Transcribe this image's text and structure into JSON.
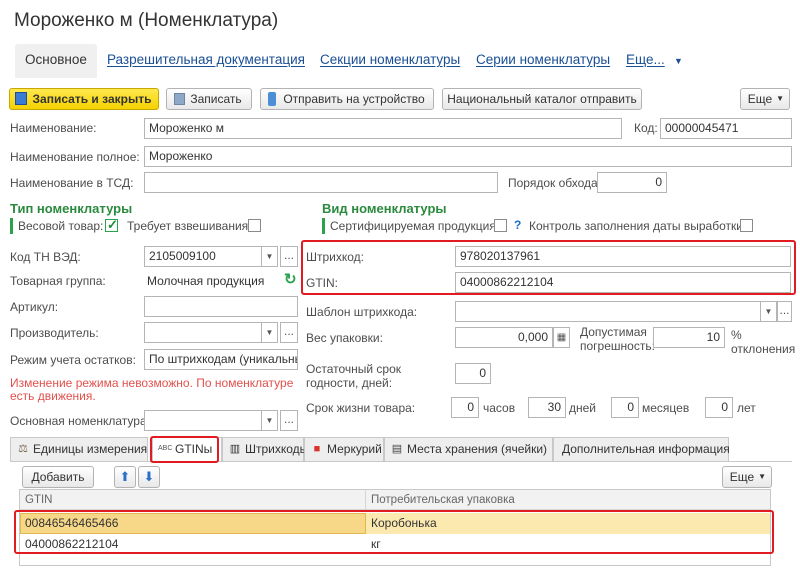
{
  "window": {
    "title": "Мороженко м (Номенклатура)"
  },
  "nav": {
    "tabs": [
      "Основное",
      "Разрешительная документация",
      "Секции номенклатуры",
      "Серии номенклатуры",
      "Еще..."
    ]
  },
  "toolbar": {
    "save_close": "Записать и закрыть",
    "save": "Записать",
    "send_device": "Отправить на устройство",
    "national_catalog": "Национальный каталог отправить",
    "more": "Еще"
  },
  "form": {
    "name_label": "Наименование:",
    "name_value": "Мороженко м",
    "code_label": "Код:",
    "code_value": "00000045471",
    "full_name_label": "Наименование полное:",
    "full_name_value": "Мороженко",
    "tsd_name_label": "Наименование в ТСД:",
    "tsd_name_value": "",
    "bypass_label": "Порядок обхода:",
    "bypass_value": "0"
  },
  "nomenclature_type": {
    "header": "Тип номенклатуры",
    "weighted_label": "Весовой товар:",
    "weighted_checked": true,
    "requires_weighing_label": "Требует взвешивания:",
    "requires_weighing_checked": false
  },
  "nomenclature_kind": {
    "header": "Вид номенклатуры",
    "certified_label": "Сертифицируемая продукция:",
    "help_mark": "?",
    "date_control_label": "Контроль заполнения даты выработки:"
  },
  "left_fields": {
    "tn_ved_label": "Код ТН ВЭД:",
    "tn_ved_value": "2105009100",
    "product_group_label": "Товарная группа:",
    "product_group_value": "Молочная продукция",
    "article_label": "Артикул:",
    "article_value": "",
    "manufacturer_label": "Производитель:",
    "manufacturer_value": "",
    "stock_mode_label": "Режим учета остатков:",
    "stock_mode_value": "По штрихкодам (уникальный",
    "stock_mode_warning": "Изменение режима невозможно. По номенклатуре есть движения.",
    "main_nomenclature_label": "Основная номенклатура:",
    "main_nomenclature_value": ""
  },
  "right_fields": {
    "barcode_label": "Штрихкод:",
    "barcode_value": "978020137961",
    "gtin_label": "GTIN:",
    "gtin_value": "04000862212104",
    "barcode_template_label": "Шаблон штрихкода:",
    "barcode_template_value": "",
    "pack_weight_label": "Вес упаковки:",
    "pack_weight_value": "0,000",
    "tolerance_label": "Допустимая погрешность:",
    "tolerance_value": "10",
    "tolerance_unit": "% отклонения",
    "residual_shelf_label": "Остаточный срок годности, дней:",
    "residual_shelf_value": "0",
    "lifetime_label": "Срок жизни товара:",
    "hours_value": "0",
    "hours_unit": "часов",
    "days_value": "30",
    "days_unit": "дней",
    "months_value": "0",
    "months_unit": "месяцев",
    "years_value": "0",
    "years_unit": "лет"
  },
  "bottom_tabs": [
    "Единицы измерения",
    "GTINы",
    "Штрихкоды",
    "Меркурий",
    "Места хранения (ячейки)",
    "Дополнительная информация"
  ],
  "bottom_toolbar": {
    "add": "Добавить",
    "more": "Еще"
  },
  "gtin_table": {
    "columns": [
      "GTIN",
      "Потребительская упаковка"
    ],
    "rows": [
      {
        "gtin": "00846546465466",
        "pack": "Коробонька"
      },
      {
        "gtin": "04000862212104",
        "pack": "кг"
      }
    ]
  },
  "colors": {
    "accent_yellow": "#f5d100",
    "link_blue": "#1a4f95",
    "section_green": "#2b8a3e",
    "highlight_red": "#e21b23",
    "selected_row": "#fbe9b0"
  }
}
